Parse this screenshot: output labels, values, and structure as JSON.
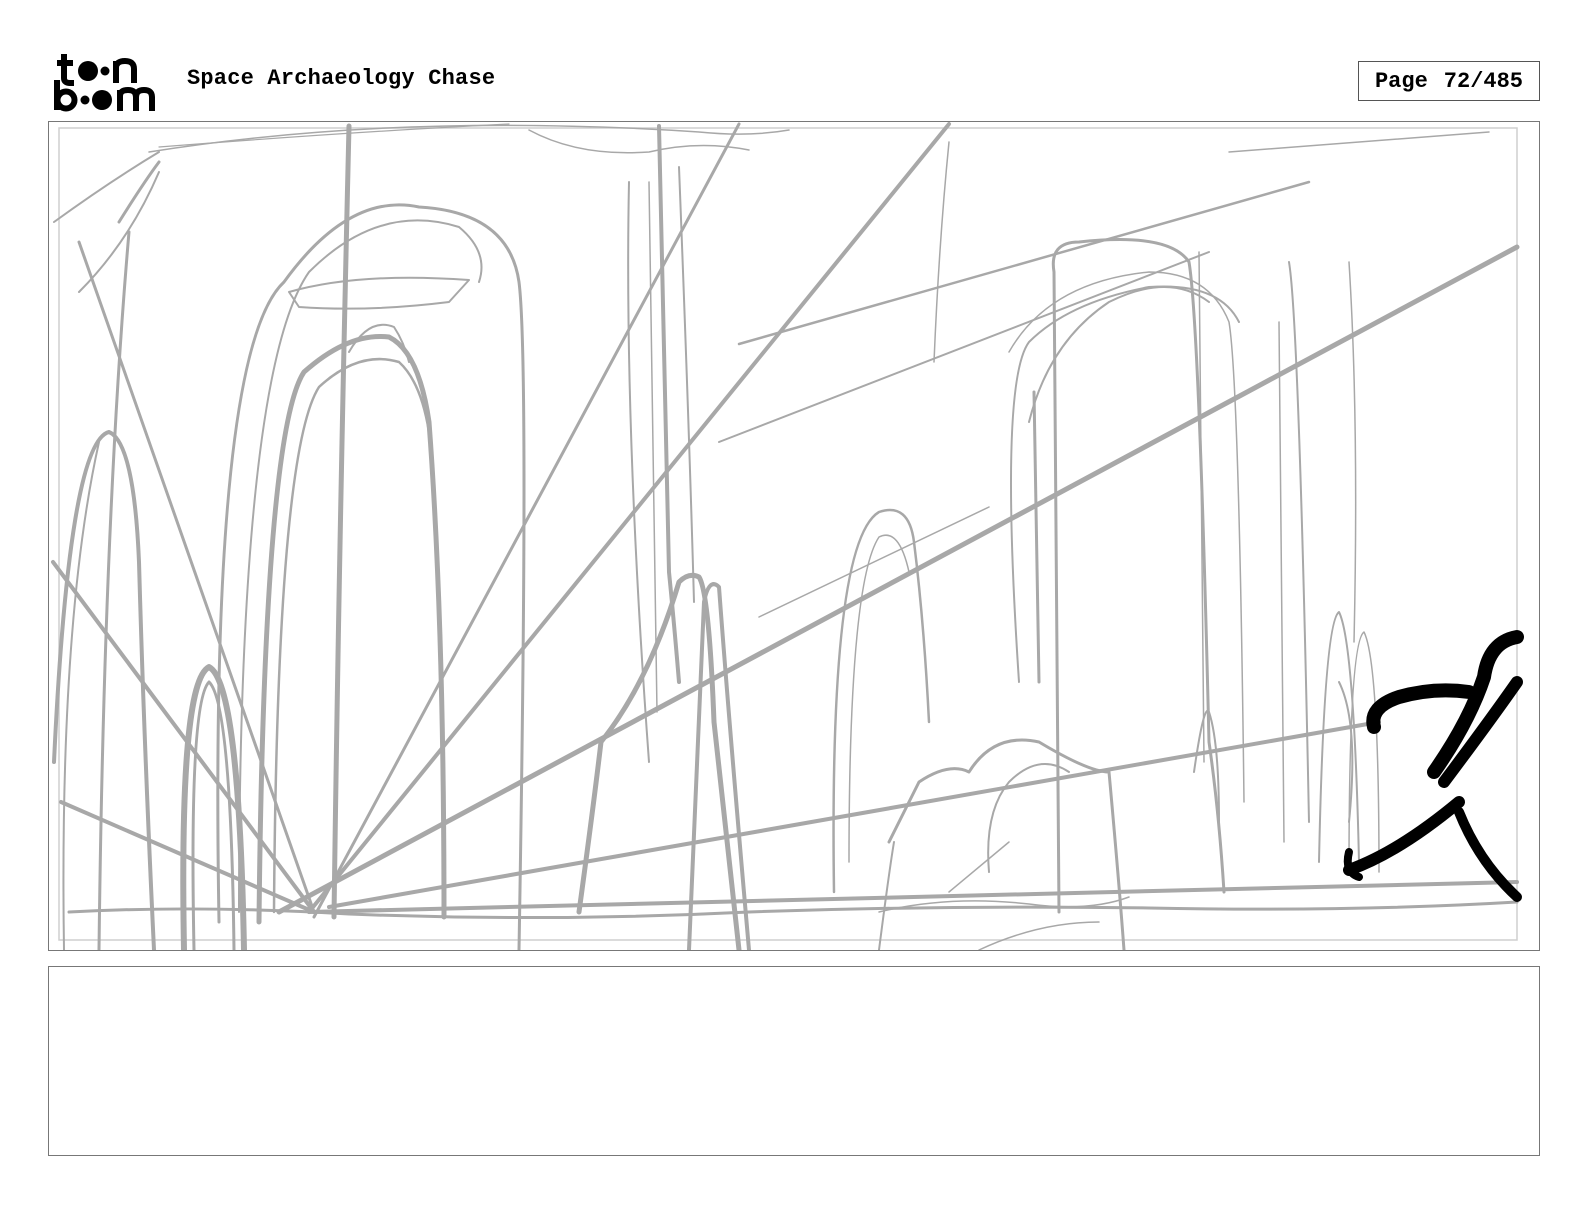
{
  "header": {
    "logo_text": "toon boom",
    "project_title": "Space Archaeology Chase",
    "page_label": "Page",
    "page_value": "72/485"
  },
  "panel": {
    "sketch_color": "#a8a8a8",
    "character_color": "#000000"
  },
  "notes": {
    "text": ""
  }
}
